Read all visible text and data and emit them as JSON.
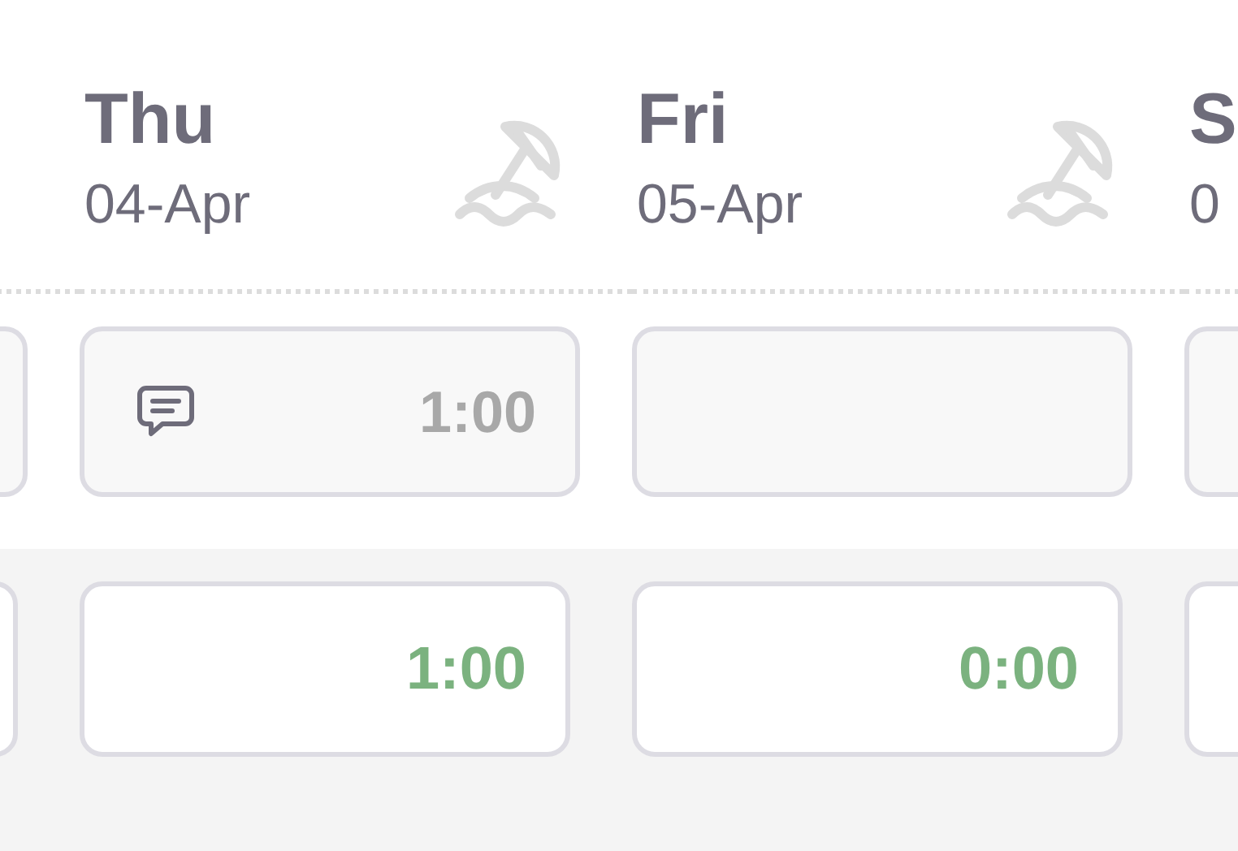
{
  "columns": [
    {},
    {
      "day": "Thu",
      "date": "04-Apr",
      "holiday": true,
      "entry": {
        "comment": true,
        "hours": "1:00"
      },
      "total": {
        "hours": "1:00"
      }
    },
    {
      "day": "Fri",
      "date": "05-Apr",
      "holiday": true,
      "entry": {
        "comment": false
      },
      "total": {
        "hours": "0:00"
      }
    },
    {
      "day": "S",
      "date": "0"
    }
  ]
}
